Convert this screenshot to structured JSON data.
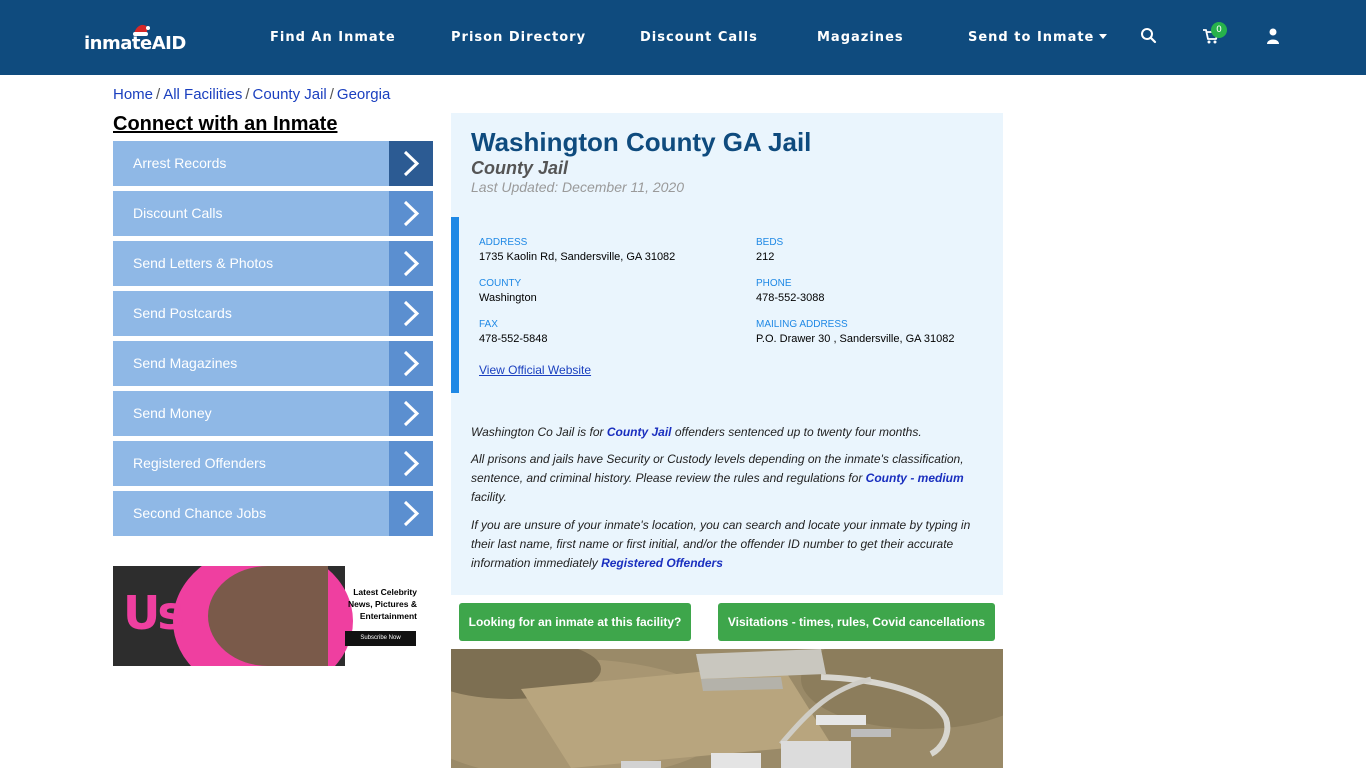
{
  "header": {
    "logo_text": "inmateAID",
    "nav": [
      "Find An Inmate",
      "Prison Directory",
      "Discount Calls",
      "Magazines",
      "Send to Inmate"
    ],
    "cart_count": "0",
    "colors": {
      "bar": "#0f4b7e",
      "badge": "#27b24a"
    }
  },
  "breadcrumb": [
    "Home",
    "All Facilities",
    "County Jail",
    "Georgia"
  ],
  "sidebar": {
    "title": "Connect with an Inmate",
    "items": [
      "Arrest Records",
      "Discount Calls",
      "Send Letters & Photos",
      "Send Postcards",
      "Send Magazines",
      "Send Money",
      "Registered Offenders",
      "Second Chance Jobs"
    ]
  },
  "ad": {
    "brand": "Us",
    "line1": "Latest Celebrity",
    "line2": "News, Pictures &",
    "line3": "Entertainment",
    "button": "Subscribe Now"
  },
  "facility": {
    "title": "Washington County GA Jail",
    "type": "County Jail",
    "updated": "Last Updated: December 11, 2020",
    "address_label": "ADDRESS",
    "address": "1735 Kaolin Rd, Sandersville, GA 31082",
    "beds_label": "BEDS",
    "beds": "212",
    "county_label": "COUNTY",
    "county": "Washington",
    "phone_label": "PHONE",
    "phone": "478-552-3088",
    "fax_label": "FAX",
    "fax": "478-552-5848",
    "mailing_label": "MAILING ADDRESS",
    "mailing": "P.O. Drawer 30 , Sandersville, GA 31082",
    "website_link": "View Official Website"
  },
  "description": {
    "p1_a": "Washington Co Jail is for ",
    "p1_link": "County Jail",
    "p1_b": " offenders sentenced up to twenty four months.",
    "p2_a": "All prisons and jails have Security or Custody levels depending on the inmate's classification, sentence, and criminal history. Please review the rules and regulations for ",
    "p2_link": "County - medium",
    "p2_b": " facility.",
    "p3_a": "If you are unsure of your inmate's location, you can search and locate your inmate by typing in their last name, first name or first initial, and/or the offender ID number to get their accurate information immediately ",
    "p3_link": "Registered Offenders"
  },
  "buttons": {
    "find": "Looking for an inmate at this facility?",
    "visit": "Visitations - times, rules, Covid cancellations"
  }
}
